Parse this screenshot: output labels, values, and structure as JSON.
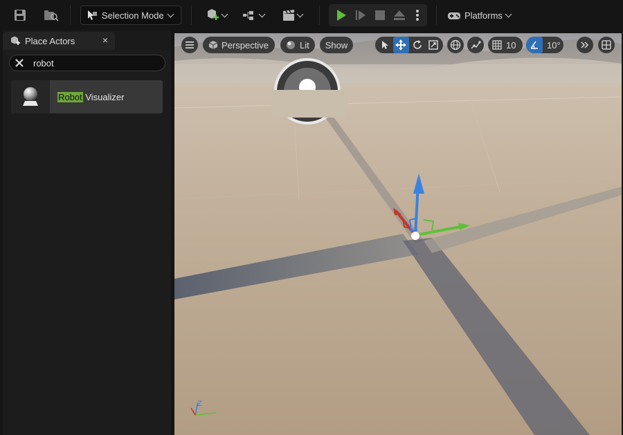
{
  "toolbar": {
    "mode_label": "Selection Mode",
    "platforms_label": "Platforms"
  },
  "panel": {
    "tab_title": "Place Actors",
    "close_glyph": "×",
    "search_value": "robot",
    "result": {
      "highlight": "Robot",
      "rest": " Visualizer"
    }
  },
  "viewport": {
    "perspective_label": "Perspective",
    "lit_label": "Lit",
    "show_label": "Show",
    "grid_snap_value": "10",
    "rotation_snap_value": "10°"
  },
  "gizmo": {
    "axis_z_label": "Z"
  },
  "colors": {
    "accent_blue": "#2f6fb5",
    "play_green": "#5fbf3a",
    "highlight_green": "#6fa83a",
    "axis_x": "#c0392b",
    "axis_y": "#5fbf3a",
    "axis_z": "#3b82e0"
  }
}
